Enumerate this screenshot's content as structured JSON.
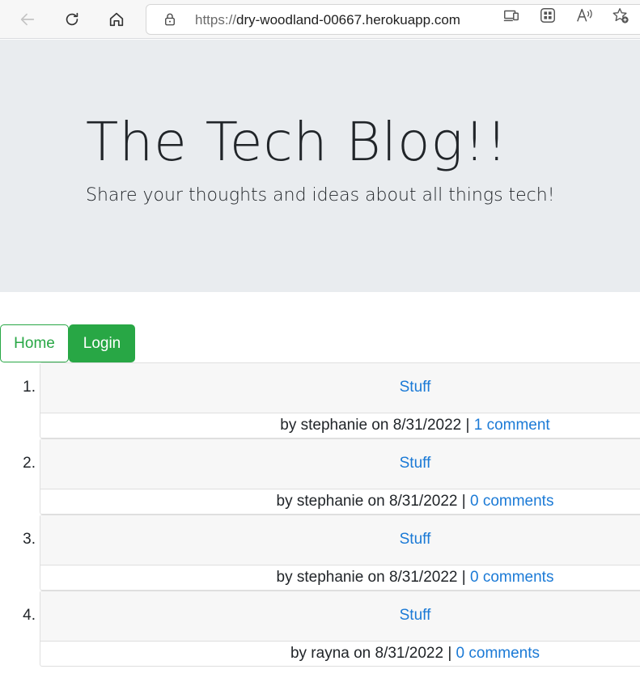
{
  "browser": {
    "url_scheme": "https://",
    "url_host": "dry-woodland-00667.herokuapp.com",
    "icons": [
      "back-icon",
      "refresh-icon",
      "home-icon",
      "lock-icon",
      "device-icon",
      "apps-icon",
      "read-aloud-icon",
      "favorite-add-icon"
    ]
  },
  "jumbotron": {
    "title": "The Tech Blog!!",
    "lead": "Share your thoughts and ideas about all things tech!"
  },
  "nav": {
    "home_label": "Home",
    "login_label": "Login"
  },
  "posts": [
    {
      "number": "1.",
      "title": "Stuff",
      "meta_prefix": "by stephanie on 8/31/2022 | ",
      "comments": "1 comment"
    },
    {
      "number": "2.",
      "title": "Stuff",
      "meta_prefix": "by stephanie on 8/31/2022 | ",
      "comments": "0 comments"
    },
    {
      "number": "3.",
      "title": "Stuff",
      "meta_prefix": "by stephanie on 8/31/2022 | ",
      "comments": "0 comments"
    },
    {
      "number": "4.",
      "title": "Stuff",
      "meta_prefix": "by rayna on 8/31/2022 | ",
      "comments": "0 comments"
    }
  ],
  "colors": {
    "accent_green": "#28a745",
    "link_blue": "#1b7ad6",
    "jumbotron_bg": "#e9ecef",
    "card_header_bg": "#f7f7f7"
  }
}
